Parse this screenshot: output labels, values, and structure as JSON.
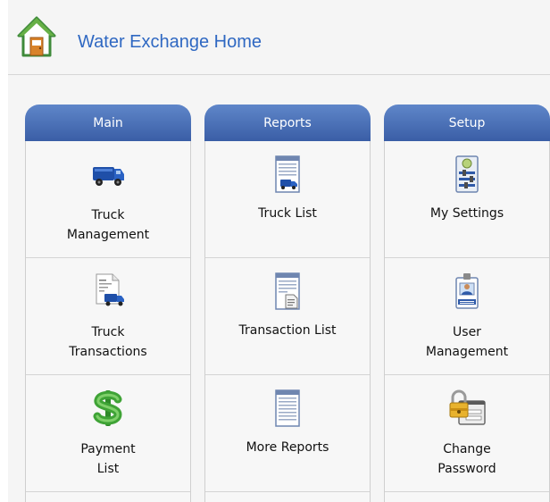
{
  "header": {
    "title": "Water Exchange Home",
    "icon": "home-icon"
  },
  "columns": [
    {
      "title": "Main",
      "tiles": [
        {
          "label_line1": "Truck",
          "label_line2": "Management",
          "icon": "truck-icon"
        },
        {
          "label_line1": "Truck",
          "label_line2": "Transactions",
          "icon": "truck-document-icon"
        },
        {
          "label_line1": "Payment",
          "label_line2": "List",
          "icon": "dollar-icon"
        }
      ]
    },
    {
      "title": "Reports",
      "tiles": [
        {
          "label_line1": "Truck List",
          "icon": "truck-report-icon"
        },
        {
          "label_line1": "Transaction List",
          "icon": "transaction-report-icon"
        },
        {
          "label_line1": "More Reports",
          "icon": "report-icon"
        }
      ]
    },
    {
      "title": "Setup",
      "tiles": [
        {
          "label_line1": "My Settings",
          "icon": "settings-icon"
        },
        {
          "label_line1": "User",
          "label_line2": "Management",
          "icon": "user-badge-icon"
        },
        {
          "label_line1": "Change",
          "label_line2": "Password",
          "icon": "lock-password-icon"
        }
      ]
    }
  ],
  "colors": {
    "header_title": "#2f68c2",
    "column_header": "#3a5ea6",
    "truck_blue": "#1f4fa8",
    "dollar_green": "#3fa336"
  }
}
